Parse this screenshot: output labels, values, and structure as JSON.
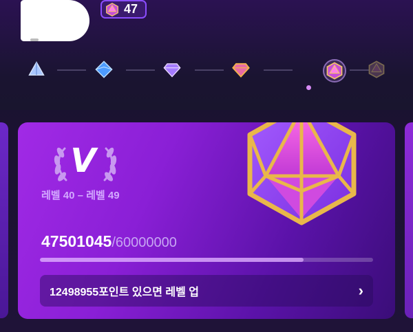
{
  "header": {
    "level_value": "47",
    "badge_icon": "gem-icon"
  },
  "tiers": [
    {
      "name": "tier-1-icon",
      "color": "#8fb7ff"
    },
    {
      "name": "tier-2-icon",
      "color": "#5aa9ff"
    },
    {
      "name": "tier-3-icon",
      "color": "#b58bff"
    },
    {
      "name": "tier-4-icon",
      "color": "#f2a340"
    },
    {
      "name": "tier-5-icon",
      "color": "#e85fd8",
      "active": true
    },
    {
      "name": "tier-6-icon",
      "color": "#7a5a86"
    }
  ],
  "card": {
    "tier_roman": "V",
    "level_range": "레벨 40 – 레벨 49",
    "progress_current": "47501045",
    "progress_total": "/60000000",
    "progress_fraction": 0.792,
    "levelup_message": "12498955포인트 있으면 레벨 업",
    "accent": "#a12ae6",
    "gem_gold": "#e9b74a"
  }
}
